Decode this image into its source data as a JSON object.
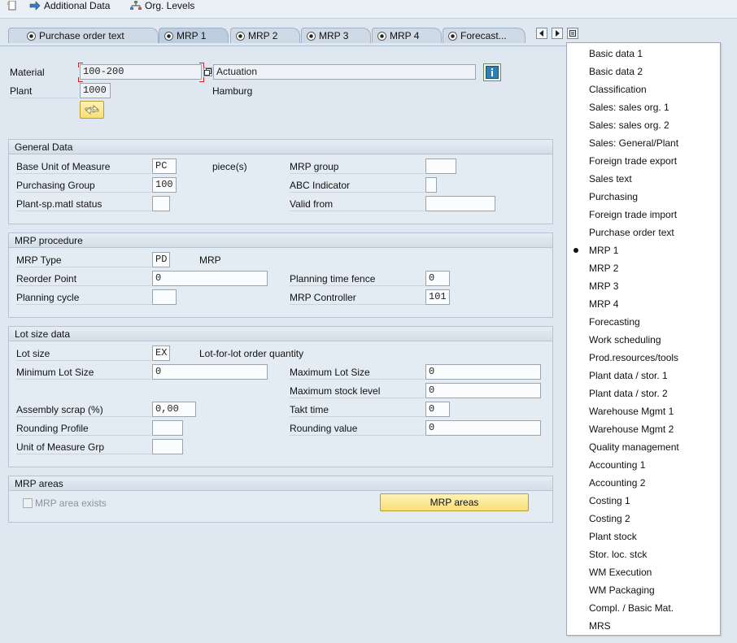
{
  "toolbar": {
    "additional_data": "Additional Data",
    "org_levels": "Org. Levels"
  },
  "tabs": [
    {
      "label": "Purchase order text"
    },
    {
      "label": "MRP 1"
    },
    {
      "label": "MRP 2"
    },
    {
      "label": "MRP 3"
    },
    {
      "label": "MRP 4"
    },
    {
      "label": "Forecast..."
    }
  ],
  "header": {
    "material_label": "Material",
    "material_value": "100-200",
    "description_value": "Actuation",
    "plant_label": "Plant",
    "plant_value": "1000",
    "plant_name": "Hamburg"
  },
  "general_data": {
    "title": "General Data",
    "base_uom_label": "Base Unit of Measure",
    "base_uom_value": "PC",
    "base_uom_text": "piece(s)",
    "mrp_group_label": "MRP group",
    "mrp_group_value": "",
    "purchasing_group_label": "Purchasing Group",
    "purchasing_group_value": "100",
    "abc_indicator_label": "ABC Indicator",
    "abc_indicator_value": "",
    "plant_status_label": "Plant-sp.matl status",
    "plant_status_value": "",
    "valid_from_label": "Valid from",
    "valid_from_value": ""
  },
  "mrp_procedure": {
    "title": "MRP procedure",
    "mrp_type_label": "MRP Type",
    "mrp_type_value": "PD",
    "mrp_type_text": "MRP",
    "reorder_point_label": "Reorder Point",
    "reorder_point_value": "0",
    "planning_fence_label": "Planning time fence",
    "planning_fence_value": "0",
    "planning_cycle_label": "Planning cycle",
    "planning_cycle_value": "",
    "mrp_controller_label": "MRP Controller",
    "mrp_controller_value": "101"
  },
  "lot_size": {
    "title": "Lot size data",
    "lot_size_label": "Lot size",
    "lot_size_value": "EX",
    "lot_size_text": "Lot-for-lot order quantity",
    "min_lot_label": "Minimum Lot Size",
    "min_lot_value": "0",
    "max_lot_label": "Maximum Lot Size",
    "max_lot_value": "0",
    "max_stock_label": "Maximum stock level",
    "max_stock_value": "0",
    "assembly_scrap_label": "Assembly scrap (%)",
    "assembly_scrap_value": "0,00",
    "takt_label": "Takt time",
    "takt_value": "0",
    "rounding_profile_label": "Rounding Profile",
    "rounding_profile_value": "",
    "rounding_value_label": "Rounding value",
    "rounding_value_value": "0",
    "uom_grp_label": "Unit of Measure Grp",
    "uom_grp_value": ""
  },
  "mrp_areas": {
    "title": "MRP areas",
    "checkbox_label": "MRP area exists",
    "button_label": "MRP areas"
  },
  "menu": {
    "selected": "MRP 1",
    "items": [
      "Basic data 1",
      "Basic data 2",
      "Classification",
      "Sales: sales org. 1",
      "Sales: sales org. 2",
      "Sales: General/Plant",
      "Foreign trade export",
      "Sales text",
      "Purchasing",
      "Foreign trade import",
      "Purchase order text",
      "MRP 1",
      "MRP 2",
      "MRP 3",
      "MRP 4",
      "Forecasting",
      "Work scheduling",
      "Prod.resources/tools",
      "Plant data / stor. 1",
      "Plant data / stor. 2",
      "Warehouse Mgmt 1",
      "Warehouse Mgmt 2",
      "Quality management",
      "Accounting 1",
      "Accounting 2",
      "Costing 1",
      "Costing 2",
      "Plant stock",
      "Stor. loc. stck",
      "WM Execution",
      "WM Packaging",
      "Compl. / Basic Mat.",
      "MRS"
    ]
  },
  "colors": {
    "background": "#dfe8f1",
    "button_yellow": "#f7df75",
    "required_marker": "#d02020"
  }
}
